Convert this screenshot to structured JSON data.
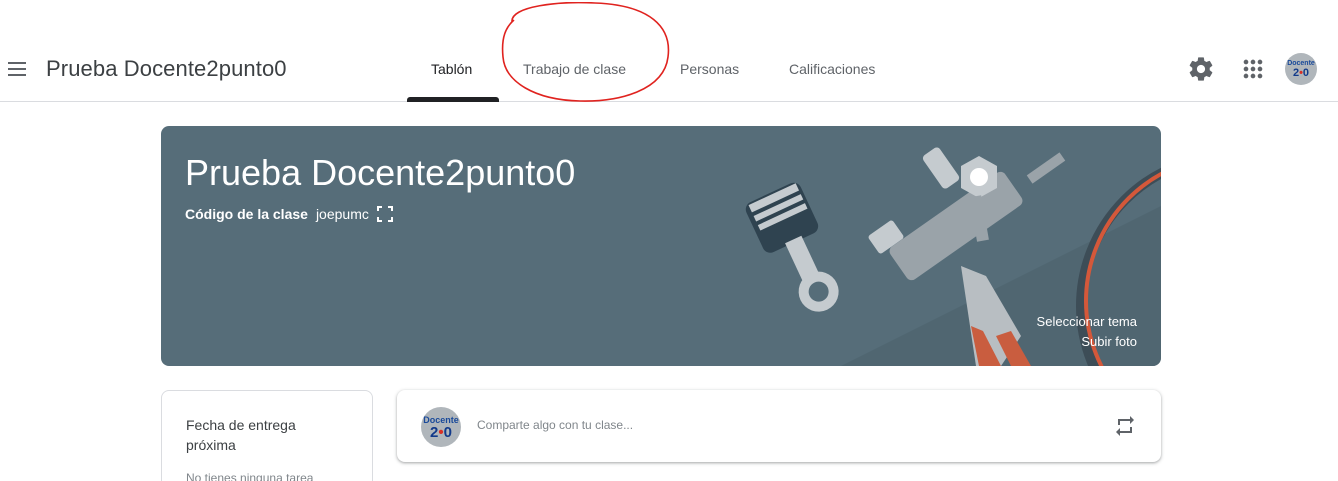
{
  "header": {
    "course_title": "Prueba Docente2punto0",
    "tabs": [
      {
        "label": "Tablón",
        "active": true
      },
      {
        "label": "Trabajo de clase",
        "active": false
      },
      {
        "label": "Personas",
        "active": false
      },
      {
        "label": "Calificaciones",
        "active": false
      }
    ],
    "icons": [
      "menu-icon",
      "gear-icon",
      "apps-grid-icon"
    ],
    "avatar": {
      "line1": "Docente",
      "line2_a": "2",
      "line2_dot": "•",
      "line2_b": "0"
    }
  },
  "banner": {
    "title": "Prueba Docente2punto0",
    "class_code_label": "Código de la clase",
    "class_code": "joepumc",
    "select_theme": "Seleccionar tema",
    "upload_photo": "Subir foto",
    "background_color": "#566d79"
  },
  "upcoming": {
    "title": "Fecha de entrega próxima",
    "text": "No tienes ninguna tarea"
  },
  "share": {
    "placeholder": "Comparte algo con tu clase...",
    "avatar": {
      "line1": "Docente",
      "line2_a": "2",
      "line2_dot": "•",
      "line2_b": "0"
    }
  },
  "colors": {
    "annotation": "#e0231f",
    "active_tab_indicator": "#202124"
  }
}
